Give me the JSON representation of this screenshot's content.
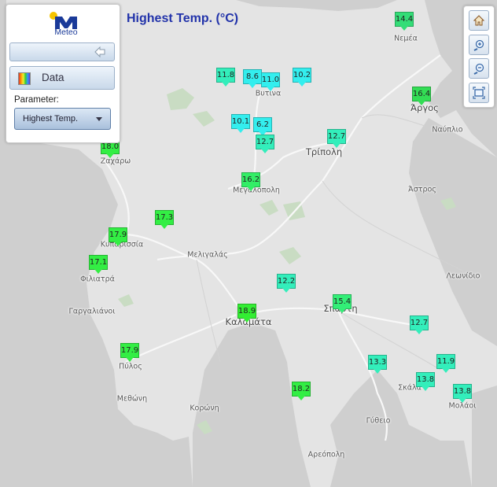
{
  "title": "Highest Temp. (°C)",
  "panel": {
    "logo_text": "Meteo",
    "data_label": "Data",
    "parameter_label": "Parameter:",
    "parameter_value": "Highest Temp."
  },
  "controls": {
    "home_icon": "home-icon",
    "zoom_in_icon": "zoom-in-icon",
    "zoom_out_icon": "zoom-out-icon",
    "extent_icon": "full-extent-icon"
  },
  "colors": {
    "cyan": "#33eeee",
    "aqua_green": "#33eebb",
    "light_green": "#55ee66",
    "green": "#33dd33"
  },
  "places": [
    "Νεμέα",
    "Άργος",
    "Ναύπλιο",
    "Βυτίνα",
    "Τρίπολη",
    "Ζαχάρω",
    "Μεγαλόπολη",
    "Άστρος",
    "Κυπαρισσία",
    "Μελιγαλάς",
    "Φιλιατρά",
    "Λεωνίδιο",
    "Γαργαλιάνοι",
    "Καλαμάτα",
    "Σπάρτη",
    "Πύλος",
    "Σκάλα",
    "Μεθώνη",
    "Κορώνη",
    "Μολάοι",
    "Γύθειο",
    "Αρεόπολη"
  ],
  "stations": [
    "14.4",
    "16.4",
    "11.8",
    "8.6",
    "11.0",
    "10.2",
    "10.1",
    "6.2",
    "12.7",
    "12.7",
    "18.0",
    "16.2",
    "17.3",
    "17.9",
    "17.1",
    "12.2",
    "15.4",
    "18.9",
    "12.7",
    "17.9",
    "13.3",
    "11.9",
    "13.8",
    "13.8",
    "18.2"
  ]
}
